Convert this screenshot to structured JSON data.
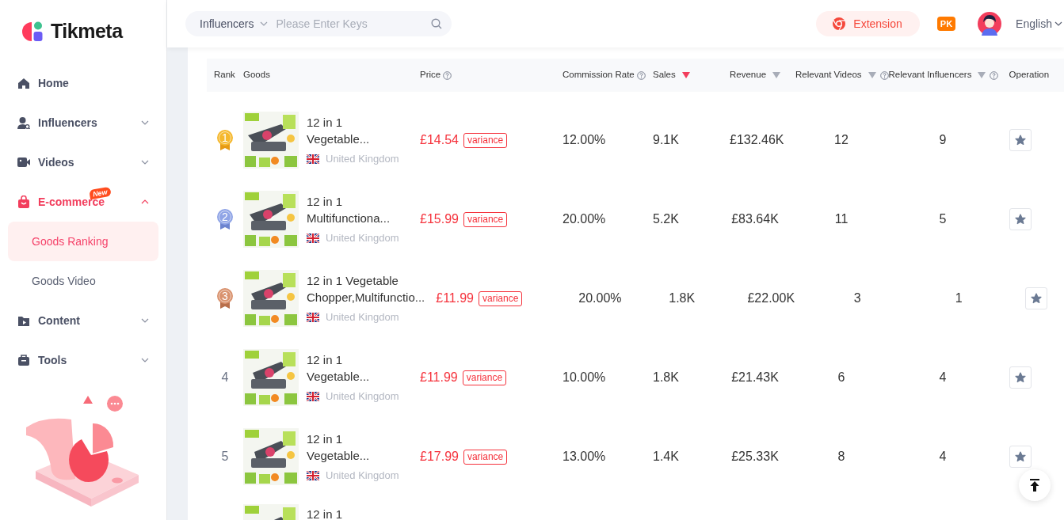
{
  "brand": {
    "name": "Tikmeta"
  },
  "sidebar": {
    "items": [
      {
        "label": "Home",
        "kind": "home",
        "selected": false
      },
      {
        "label": "Influencers",
        "kind": "influencer",
        "selected": false,
        "expanded": false
      },
      {
        "label": "Videos",
        "kind": "video",
        "selected": false,
        "expanded": false
      },
      {
        "label": "E-commerce",
        "kind": "bag",
        "selected": true,
        "expanded": true,
        "badge": "New",
        "children": [
          {
            "label": "Goods Ranking",
            "selected": true
          },
          {
            "label": "Goods Video",
            "selected": false
          }
        ]
      },
      {
        "label": "Content",
        "kind": "folder",
        "selected": false,
        "expanded": false
      },
      {
        "label": "Tools",
        "kind": "briefcase",
        "selected": false,
        "expanded": false
      }
    ]
  },
  "search": {
    "scope": "Influencers",
    "placeholder": "Please Enter Keys"
  },
  "header": {
    "extension": "Extension",
    "pk": "PK",
    "language": "English"
  },
  "table": {
    "columns": [
      {
        "label": "Rank",
        "help": false,
        "sortable": false
      },
      {
        "label": "Goods",
        "help": false,
        "sortable": false
      },
      {
        "label": "Price",
        "help": true,
        "sortable": false
      },
      {
        "label": "Commission Rate",
        "help": true,
        "sortable": false
      },
      {
        "label": "Sales",
        "help": false,
        "sortable": true,
        "sorted": true
      },
      {
        "label": "Revenue",
        "help": false,
        "sortable": true,
        "sorted": false
      },
      {
        "label": "Relevant Videos",
        "help": true,
        "sortable": true,
        "sorted": false
      },
      {
        "label": "Relevant Influencers",
        "help": true,
        "sortable": true,
        "sorted": false
      },
      {
        "label": "Operation",
        "help": false,
        "sortable": false
      }
    ],
    "rows": [
      {
        "rank": "1",
        "kind": "medal",
        "name_lines": [
          "12 in 1",
          "Vegetable..."
        ],
        "country": "United Kingdom",
        "price": "£14.54",
        "tag": "variance",
        "commission": "12.00%",
        "sales": "9.1K",
        "revenue": "£132.46K",
        "videos": "12",
        "influencers": "9",
        "favorited": false
      },
      {
        "rank": "2",
        "kind": "medal",
        "name_lines": [
          "12 in 1",
          "Multifunctiona..."
        ],
        "country": "United Kingdom",
        "price": "£15.99",
        "tag": "variance",
        "commission": "20.00%",
        "sales": "5.2K",
        "revenue": "£83.64K",
        "videos": "11",
        "influencers": "5",
        "favorited": false
      },
      {
        "rank": "3",
        "kind": "medal",
        "name_lines": [
          "12 in 1 Vegetable",
          "Chopper,Multifunctio..."
        ],
        "country": "United Kingdom",
        "price": "£11.99",
        "tag": "variance",
        "commission": "20.00%",
        "sales": "1.8K",
        "revenue": "£22.00K",
        "videos": "3",
        "influencers": "1",
        "favorited": false
      },
      {
        "rank": "4",
        "kind": "plain",
        "name_lines": [
          "12 in 1",
          "Vegetable..."
        ],
        "country": "United Kingdom",
        "price": "£11.99",
        "tag": "variance",
        "commission": "10.00%",
        "sales": "1.8K",
        "revenue": "£21.43K",
        "videos": "6",
        "influencers": "4",
        "favorited": false
      },
      {
        "rank": "5",
        "kind": "plain",
        "name_lines": [
          "12 in 1",
          "Vegetable..."
        ],
        "country": "United Kingdom",
        "price": "£17.99",
        "tag": "variance",
        "commission": "13.00%",
        "sales": "1.4K",
        "revenue": "£25.33K",
        "videos": "8",
        "influencers": "4",
        "favorited": false
      },
      {
        "name_lines": [
          "12 in 1"
        ]
      }
    ]
  }
}
